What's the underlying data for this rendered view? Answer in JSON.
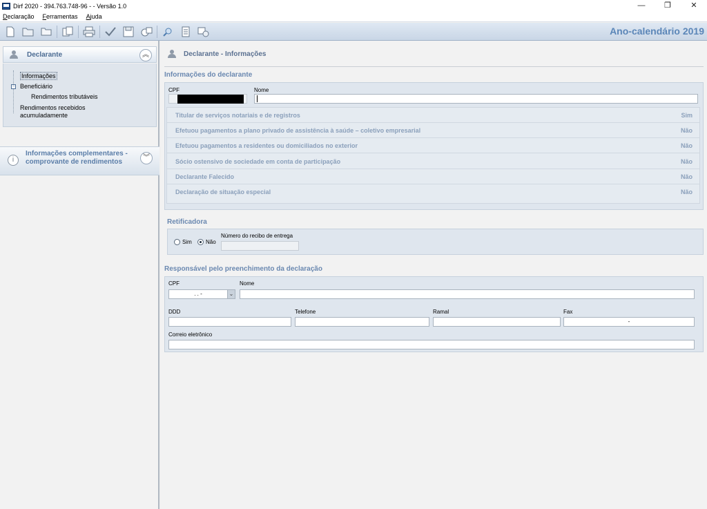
{
  "window": {
    "title": "Dirf 2020 - 394.763.748-96 -  - Versão 1.0",
    "controls": [
      "—",
      "❐",
      "✕"
    ]
  },
  "menu": [
    "Declaração",
    "Ferramentas",
    "Ajuda"
  ],
  "toolbar": {
    "buttons": [
      "new-file-icon",
      "open-folder-icon",
      "folder-icon",
      "copy-icon",
      "print-icon",
      "check-icon",
      "save-icon",
      "export-icon",
      "search-icon",
      "report-icon",
      "transfer-icon"
    ],
    "year_title": "Ano-calendário 2019"
  },
  "sidebar": {
    "declarante": {
      "title": "Declarante",
      "tree": {
        "informacoes": "Informações",
        "beneficiario": "Beneficiário",
        "rendimentos_tributaveis": "Rendimentos tributáveis",
        "rra_line1": "Rendimentos recebidos",
        "rra_line2": "acumuladamente"
      }
    },
    "info_complementares": {
      "title_line1": "Informações complementares -",
      "title_line2": "comprovante de rendimentos"
    }
  },
  "main": {
    "page_title": "Declarante - Informações",
    "declarante_section": {
      "title": "Informações do declarante",
      "cpf_label": "CPF",
      "nome_label": "Nome",
      "nome_value": ""
    },
    "questions": [
      {
        "text": "Titular de serviços notariais e de registros",
        "value": "Sim"
      },
      {
        "text": "Efetuou pagamentos a plano privado de assistência à saúde – coletivo empresarial",
        "value": "Não"
      },
      {
        "text": "Efetuou pagamentos a residentes ou domiciliados no exterior",
        "value": "Não"
      },
      {
        "text": "Sócio ostensivo de sociedade em conta de participação",
        "value": "Não"
      },
      {
        "text": "Declarante Falecido",
        "value": "Não"
      },
      {
        "text": "Declaração de situação especial",
        "value": "Não"
      }
    ],
    "retificadora": {
      "title": "Retificadora",
      "opt_sim": "Sim",
      "opt_nao": "Não",
      "selected": "Não",
      "recibo_label": "Número do recibo de entrega"
    },
    "responsavel": {
      "title": "Responsável pelo preenchimento da declaração",
      "cpf_label": "CPF",
      "cpf_value": ".   .   -",
      "nome_label": "Nome",
      "ddd_label": "DDD",
      "telefone_label": "Telefone",
      "ramal_label": "Ramal",
      "fax_label": "Fax",
      "fax_value": "-",
      "email_label": "Correio eletrônico"
    }
  }
}
